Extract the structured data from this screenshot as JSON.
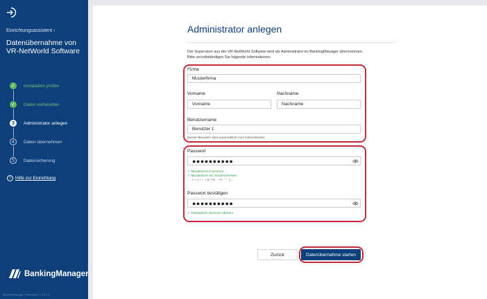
{
  "sidebar": {
    "wizard_label": "Einrichtungsassistent ›",
    "title": "Datenübernahme von VR-NetWorld Software",
    "steps": [
      {
        "number": "1",
        "label": "Installation prüfen",
        "state": "done"
      },
      {
        "number": "2",
        "label": "Daten vorbereiten",
        "state": "done"
      },
      {
        "number": "3",
        "label": "Administrator anlegen",
        "state": "active"
      },
      {
        "number": "4",
        "label": "Daten übernehmen",
        "state": "todo"
      },
      {
        "number": "5",
        "label": "Datensicherung",
        "state": "todo"
      }
    ],
    "help_link": "Hilfe zur Einrichtung",
    "brand": "BankingManager",
    "version": "BankingManager Testversion 1.5.0.13"
  },
  "form": {
    "title": "Administrator anlegen",
    "intro": "Der Supervisor aus der VR-NetWorld Software wird als Administrator im BankingManager übernommen. Bitte vervollständigen Sie folgende Informationen.",
    "firma": {
      "label": "Firma",
      "value": "Musterfirma"
    },
    "vorname": {
      "label": "Vorname",
      "value": "Vorname"
    },
    "nachname": {
      "label": "Nachname",
      "value": "Nachname"
    },
    "benutzername": {
      "label": "Benutzername",
      "value": "Benutzer 1",
      "hint": "Dieser Benutzer wird automatisch zum Administrator."
    },
    "passwort": {
      "label": "Passwort",
      "value": "●●●●●●●●●●",
      "rules": [
        "✓ Mindestens 8 Zeichen",
        "✓ Mindestens ein Sonderzeichen:",
        ". < > | ! ~ = & ? € ; , % ' \" ' ] ="
      ]
    },
    "passwort_bestaetigen": {
      "label": "Passwort bestätigen",
      "value": "●●●●●●●●●●",
      "match": "✓ Passwörter stimmen überein"
    },
    "back_label": "Zurück",
    "start_label": "Datenübernahme starten"
  },
  "colors": {
    "sidebar": "#0d3f7a",
    "accent": "#0d3f7a",
    "highlight": "#c42a3a",
    "success": "#2e9b46"
  }
}
